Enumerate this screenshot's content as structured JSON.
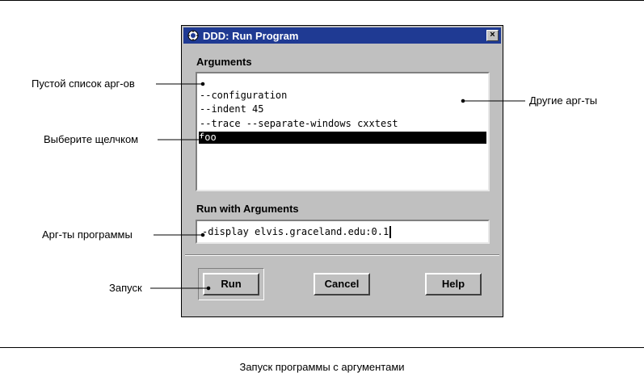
{
  "window": {
    "title": "DDD: Run Program",
    "close_label": "×"
  },
  "arguments": {
    "label": "Arguments",
    "items": [
      "",
      "--configuration",
      "--indent 45",
      "--trace --separate-windows cxxtest",
      "foo"
    ],
    "selected_index": 4
  },
  "run_with": {
    "label": "Run with Arguments",
    "value": "-display elvis.graceland.edu:0.1"
  },
  "buttons": {
    "run": "Run",
    "cancel": "Cancel",
    "help": "Help"
  },
  "callouts": {
    "empty_list": "Пустой список арг-ов",
    "click_select": "Выберите щелчком",
    "program_args": "Арг-ты программы",
    "launch": "Запуск",
    "other_args": "Другие арг-ты"
  },
  "caption": "Запуск программы с аргументами"
}
